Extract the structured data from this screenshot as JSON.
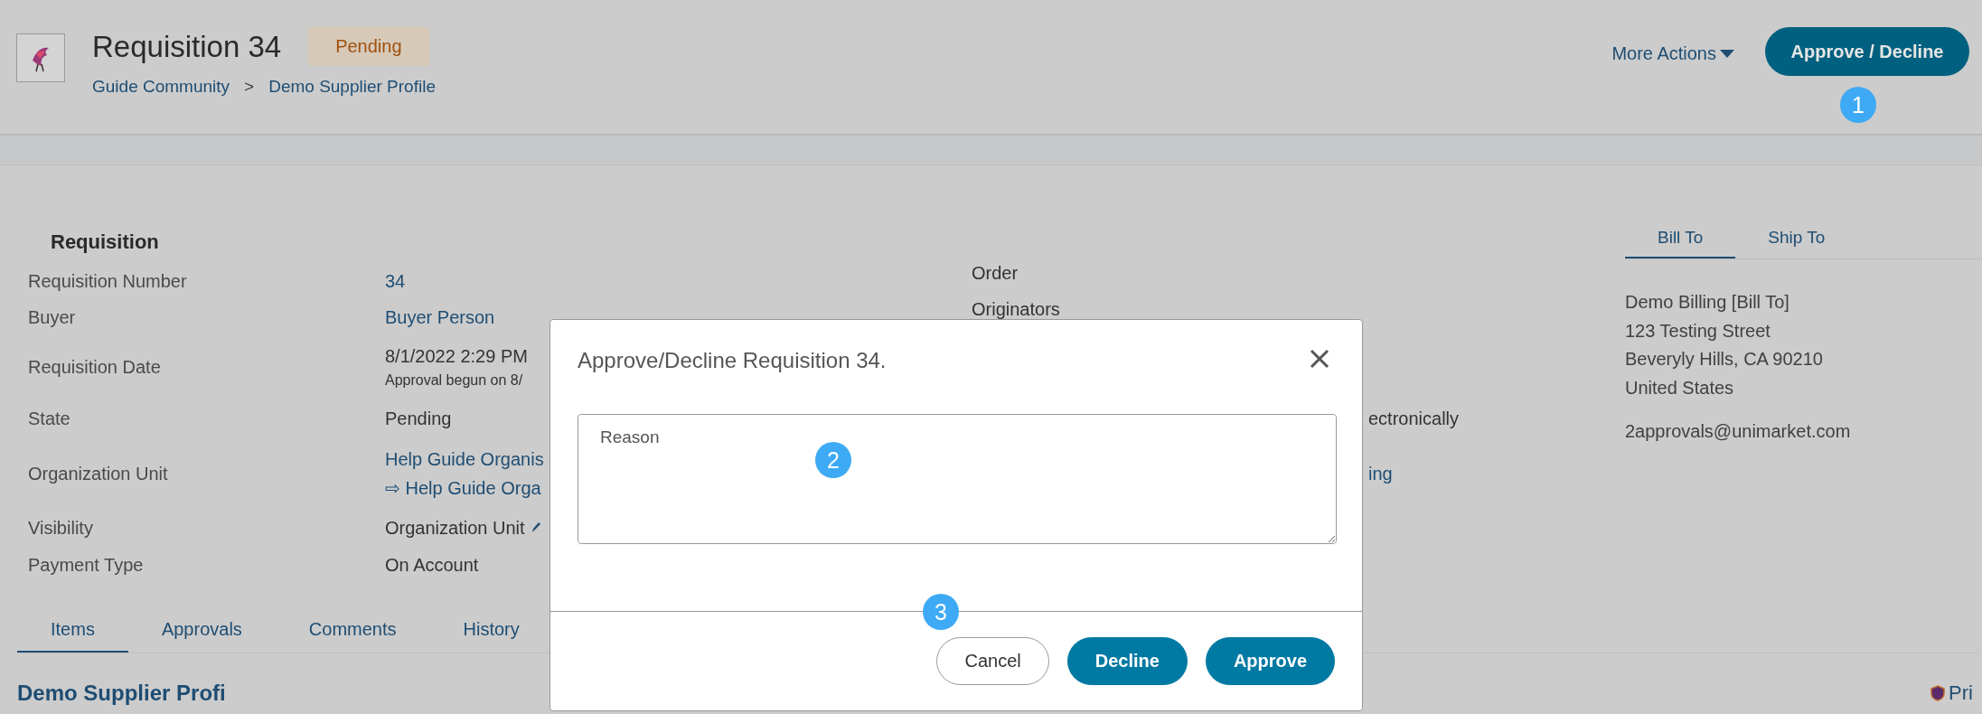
{
  "header": {
    "title": "Requisition 34",
    "status": "Pending",
    "breadcrumb": [
      "Guide Community",
      "Demo Supplier Profile"
    ],
    "separator": ">",
    "more_actions": "More Actions",
    "primary_button": "Approve / Decline",
    "marker": "1"
  },
  "details": {
    "heading": "Requisition",
    "rows": [
      {
        "label": "Requisition Number",
        "values": [
          {
            "text": "34",
            "kind": "link"
          }
        ],
        "middle": {
          "text": "Order",
          "kind": "plain"
        }
      },
      {
        "label": "Buyer",
        "values": [
          {
            "text": "Buyer Person",
            "kind": "link"
          }
        ],
        "middle": {
          "text": "Originators",
          "kind": "plain"
        }
      },
      {
        "label": "Requisition Date",
        "values": [
          {
            "text": "8/1/2022 2:29 PM",
            "kind": "plain"
          },
          {
            "text": "Approval begun on 8/",
            "kind": "small"
          }
        ]
      },
      {
        "label": "State",
        "values": [
          {
            "text": "Pending",
            "kind": "plain"
          }
        ],
        "end": {
          "text": "ectronically",
          "kind": "plain"
        }
      },
      {
        "label": "Organization Unit",
        "values": [
          {
            "text": "Help Guide Organis",
            "kind": "link"
          },
          {
            "text": "⇨ Help Guide Orga",
            "kind": "link"
          }
        ],
        "end": {
          "text": "ing",
          "kind": "link"
        }
      },
      {
        "label": "Visibility",
        "values": [
          {
            "text": "Organization Unit",
            "kind": "edit"
          }
        ]
      },
      {
        "label": "Payment Type",
        "values": [
          {
            "text": "On Account",
            "kind": "plain"
          }
        ]
      }
    ]
  },
  "address": {
    "tabs": [
      {
        "label": "Bill To",
        "selected": true
      },
      {
        "label": "Ship To",
        "selected": false
      }
    ],
    "lines": [
      "Demo Billing [Bill To]",
      "123 Testing Street",
      "Beveryly Hills, CA 90210",
      "United States"
    ],
    "email": "2approvals@unimarket.com"
  },
  "tabs": [
    {
      "label": "Items",
      "selected": true
    },
    {
      "label": "Approvals",
      "selected": false
    },
    {
      "label": "Comments",
      "selected": false
    },
    {
      "label": "History",
      "selected": false
    }
  ],
  "section_title": "Demo Supplier Profi",
  "print": "Pri",
  "modal": {
    "title": "Approve/Decline Requisition 34.",
    "reason": {
      "placeholder": "Reason",
      "marker": "2"
    },
    "marker": "3",
    "buttons": [
      {
        "label": "Cancel",
        "kind": "secondary"
      },
      {
        "label": "Decline",
        "kind": "primary"
      },
      {
        "label": "Approve",
        "kind": "primary"
      }
    ]
  }
}
